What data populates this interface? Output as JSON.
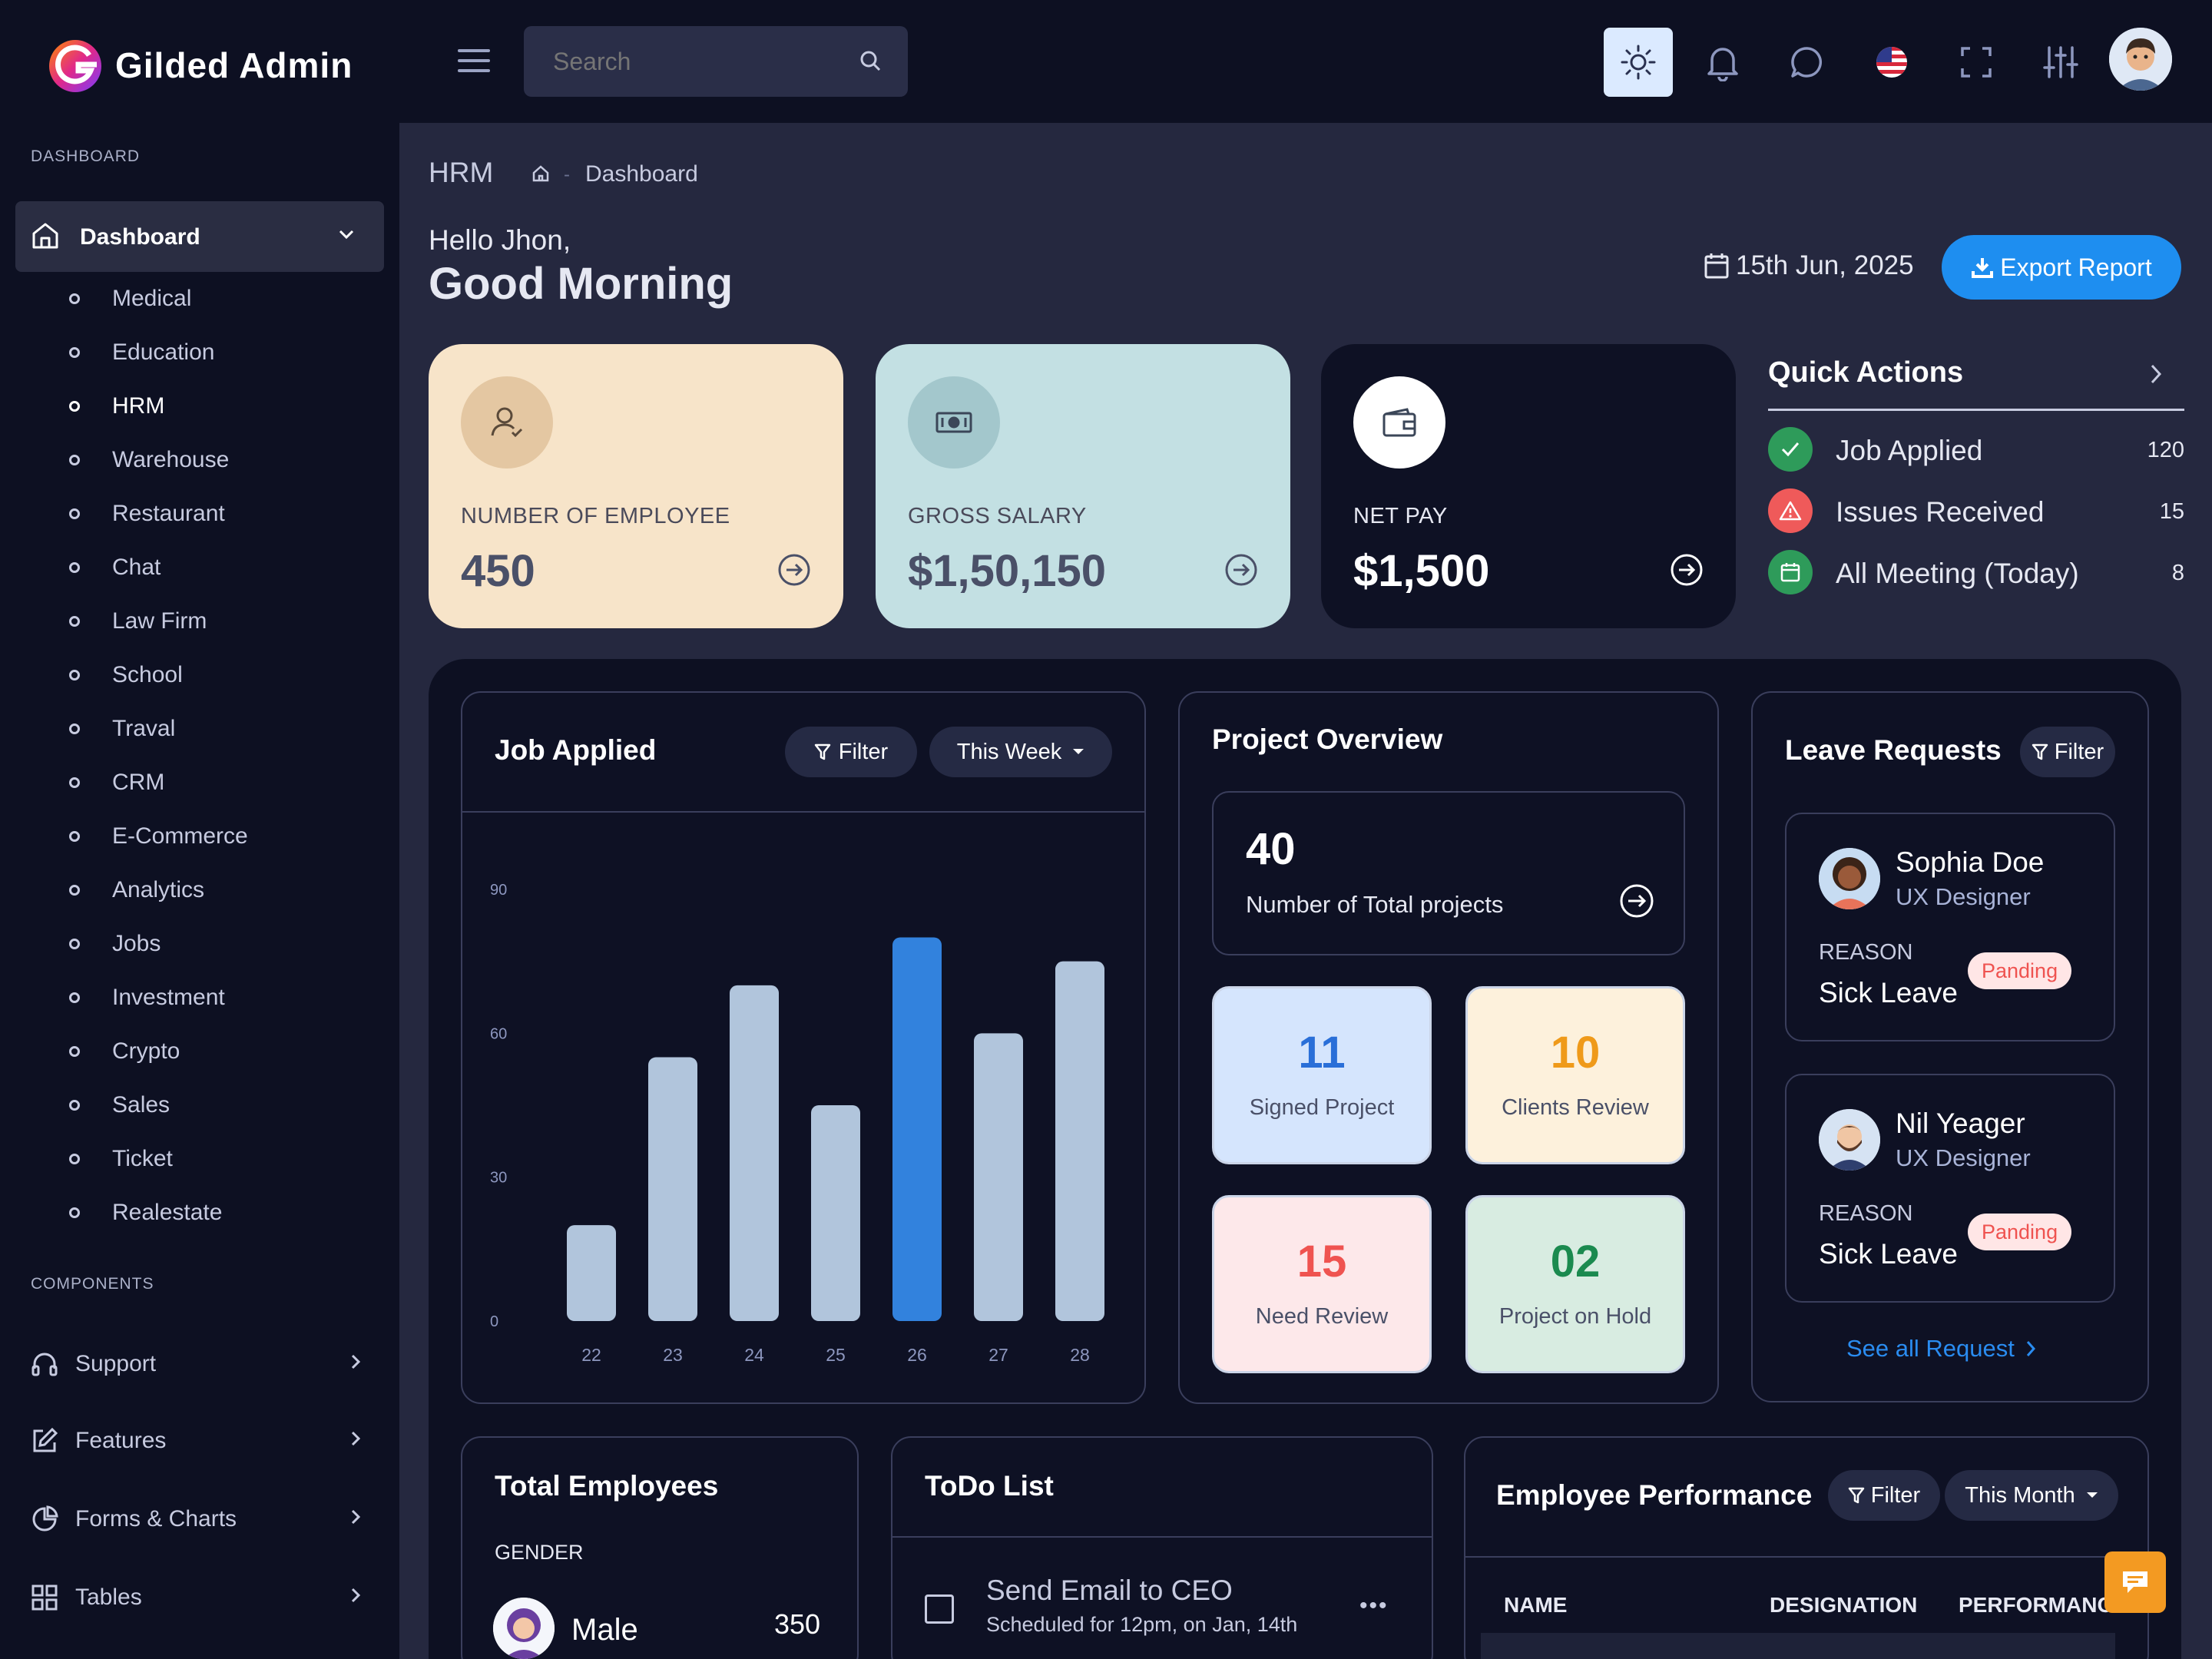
{
  "app": {
    "title": "Gilded Admin"
  },
  "header": {
    "search_placeholder": "Search"
  },
  "sidebar": {
    "section_dashboard": "DASHBOARD",
    "dashboard_label": "Dashboard",
    "sub_items": [
      "Medical",
      "Education",
      "HRM",
      "Warehouse",
      "Restaurant",
      "Chat",
      "Law Firm",
      "School",
      "Traval",
      "CRM",
      "E-Commerce",
      "Analytics",
      "Jobs",
      "Investment",
      "Crypto",
      "Sales",
      "Ticket",
      "Realestate"
    ],
    "active_item": "HRM",
    "section_components": "COMPONENTS",
    "components": [
      "Support",
      "Features",
      "Forms & Charts",
      "Tables"
    ]
  },
  "page": {
    "title": "HRM",
    "breadcrumb": "Dashboard",
    "greeting": "Hello Jhon,",
    "subgreeting": "Good Morning",
    "date": "15th Jun, 2025",
    "export_label": "Export Report"
  },
  "cards": [
    {
      "label": "NUMBER OF EMPLOYEE",
      "value": "450"
    },
    {
      "label": "GROSS SALARY",
      "value": "$1,50,150"
    },
    {
      "label": "NET PAY",
      "value": "$1,500"
    }
  ],
  "quick_actions": {
    "title": "Quick Actions",
    "items": [
      {
        "label": "Job Applied",
        "count": "120"
      },
      {
        "label": "Issues Received",
        "count": "15"
      },
      {
        "label": "All Meeting (Today)",
        "count": "8"
      }
    ]
  },
  "job_applied": {
    "title": "Job Applied",
    "filter_label": "Filter",
    "range_label": "This Week"
  },
  "chart_data": {
    "type": "bar",
    "categories": [
      "22",
      "23",
      "24",
      "25",
      "26",
      "27",
      "28"
    ],
    "values": [
      20,
      55,
      70,
      45,
      80,
      60,
      75
    ],
    "highlight_index": 4,
    "yticks": [
      "90",
      "60",
      "30",
      "0"
    ],
    "ylim": [
      0,
      90
    ],
    "grid": false,
    "colors": {
      "bar": "#b1c5dc",
      "highlight": "#3282dd"
    }
  },
  "project_overview": {
    "title": "Project Overview",
    "total_value": "40",
    "total_label": "Number of Total projects",
    "stats": [
      {
        "value": "11",
        "label": "Signed Project",
        "color": "#2a6fd8",
        "bg": "#d5e5fd"
      },
      {
        "value": "10",
        "label": "Clients Review",
        "color": "#ef9a1a",
        "bg": "#fdf1dc"
      },
      {
        "value": "15",
        "label": "Need Review",
        "color": "#ef5350",
        "bg": "#fde8ea"
      },
      {
        "value": "02",
        "label": "Project on Hold",
        "color": "#1b8a4f",
        "bg": "#d8ece1"
      }
    ]
  },
  "leave_requests": {
    "title": "Leave Requests",
    "filter_label": "Filter",
    "items": [
      {
        "name": "Sophia Doe",
        "role": "UX Designer",
        "reason_label": "REASON",
        "reason": "Sick Leave",
        "status": "Panding"
      },
      {
        "name": "Nil Yeager",
        "role": "UX Designer",
        "reason_label": "REASON",
        "reason": "Sick Leave",
        "status": "Panding"
      }
    ],
    "see_all": "See all Request"
  },
  "total_employees": {
    "title": "Total Employees",
    "gender_label": "GENDER",
    "male_label": "Male",
    "male_count": "350"
  },
  "todo": {
    "title": "ToDo List",
    "item_title": "Send Email to CEO",
    "item_sub": "Scheduled for 12pm, on Jan, 14th"
  },
  "performance": {
    "title": "Employee Performance",
    "filter_label": "Filter",
    "range_label": "This Month",
    "columns": [
      "NAME",
      "DESIGNATION",
      "PERFORMANC"
    ]
  }
}
